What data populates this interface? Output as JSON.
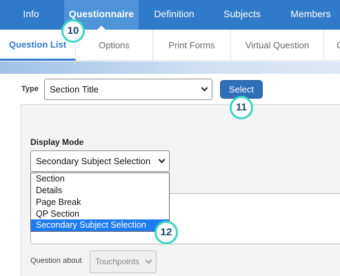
{
  "topnav": {
    "items": [
      {
        "label": "Info"
      },
      {
        "label": "Questionnaire"
      },
      {
        "label": "Definition"
      },
      {
        "label": "Subjects"
      },
      {
        "label": "Members"
      }
    ],
    "active_index": 1
  },
  "subtabs": {
    "items": [
      {
        "label": "Question List"
      },
      {
        "label": "Options"
      },
      {
        "label": "Print Forms"
      },
      {
        "label": "Virtual Question"
      },
      {
        "label": "C"
      }
    ],
    "active_index": 0
  },
  "type_row": {
    "label": "Type",
    "value": "Section Title",
    "select_button": "Select"
  },
  "display_mode": {
    "label": "Display Mode",
    "value": "Secondary Subject Selection",
    "options": [
      "Section",
      "Details",
      "Page Break",
      "QP Section",
      "Secondary Subject Selection"
    ],
    "selected_index": 4
  },
  "question_about": {
    "label": "Question about",
    "value": "Touchpoints"
  },
  "callouts": [
    "10",
    "11",
    "12"
  ],
  "colors": {
    "nav_bg": "#2f7ac9",
    "nav_active": "#4f93d9",
    "button": "#2f6fb8",
    "selected_option": "#1e7cf0",
    "callout_ring": "#3dd6c2"
  }
}
